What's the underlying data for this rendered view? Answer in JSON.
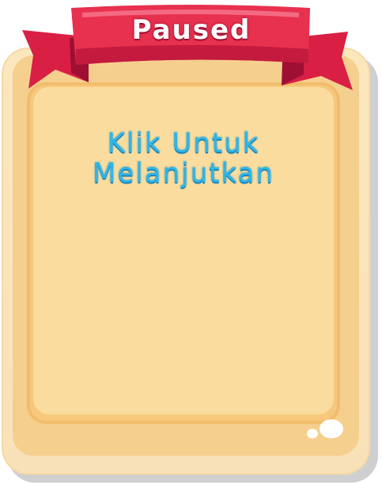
{
  "dialog": {
    "title": "Paused",
    "message_line1": "Klik Untuk",
    "message_line2": "Melanjutkan"
  },
  "colors": {
    "ribbon": "#e8304f",
    "ribbon_dark": "#b7123a",
    "card": "#fbe7bd",
    "panel": "#f9dc9e",
    "message_text": "#2fb6e8"
  }
}
